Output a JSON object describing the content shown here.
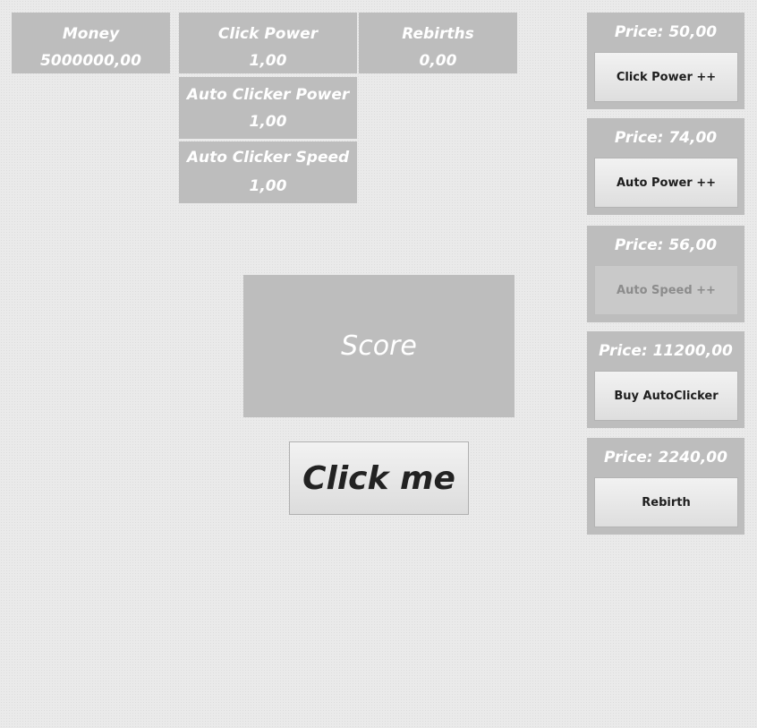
{
  "stats": {
    "money": {
      "label": "Money",
      "value": "5000000,00"
    },
    "click_power": {
      "label": "Click Power",
      "value": "1,00"
    },
    "rebirths": {
      "label": "Rebirths",
      "value": "0,00"
    },
    "auto_clicker_power": {
      "label": "Auto Clicker Power",
      "value": "1,00"
    },
    "auto_clicker_speed": {
      "label": "Auto Clicker Speed",
      "value": "1,00"
    }
  },
  "score": {
    "label": "Score"
  },
  "click_button": {
    "label": "Click me"
  },
  "shop": [
    {
      "price": "Price: 50,00",
      "button": "Click Power ++",
      "enabled": true
    },
    {
      "price": "Price: 74,00",
      "button": "Auto Power ++",
      "enabled": true
    },
    {
      "price": "Price: 56,00",
      "button": "Auto Speed ++",
      "enabled": false
    },
    {
      "price": "Price: 11200,00",
      "button": "Buy AutoClicker",
      "enabled": true
    },
    {
      "price": "Price: 2240,00",
      "button": "Rebirth",
      "enabled": true
    }
  ]
}
